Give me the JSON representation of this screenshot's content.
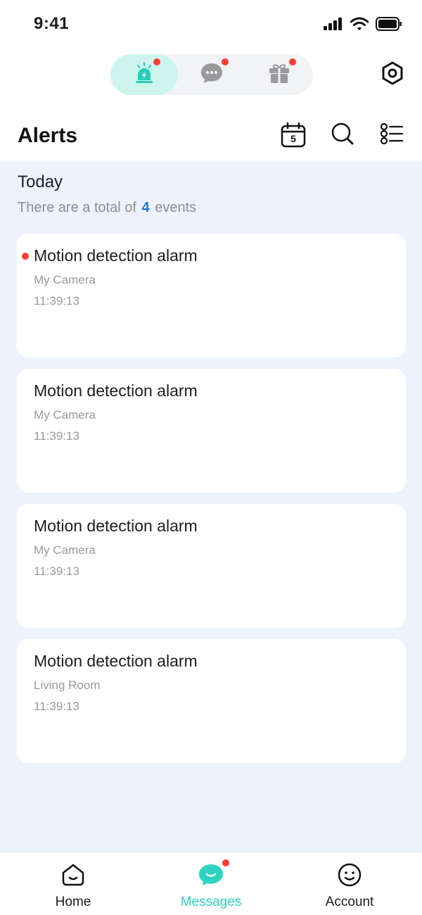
{
  "status_bar": {
    "time": "9:41"
  },
  "top_tabs": [
    {
      "name": "alerts",
      "icon": "siren-icon",
      "active": true,
      "badge": true
    },
    {
      "name": "chat",
      "icon": "chat-bubble-icon",
      "active": false,
      "badge": true
    },
    {
      "name": "gifts",
      "icon": "gift-icon",
      "active": false,
      "badge": true
    }
  ],
  "header": {
    "title": "Alerts",
    "calendar_day": "5"
  },
  "summary": {
    "day": "Today",
    "prefix": "There are a total of",
    "count": "4",
    "suffix": "events"
  },
  "events": [
    {
      "title": "Motion detection alarm",
      "device": "My Camera",
      "time": "11:39:13",
      "unread": true
    },
    {
      "title": "Motion detection alarm",
      "device": "My Camera",
      "time": "11:39:13",
      "unread": false
    },
    {
      "title": "Motion detection alarm",
      "device": "My Camera",
      "time": "11:39:13",
      "unread": false
    },
    {
      "title": "Motion detection alarm",
      "device": "Living Room",
      "time": "11:39:13",
      "unread": false
    }
  ],
  "bottom_nav": {
    "home": "Home",
    "messages": "Messages",
    "account": "Account"
  },
  "colors": {
    "accent": "#2ed3c1",
    "badge": "#ff3b30",
    "link": "#1a73e8",
    "list_background": "#eef2fd"
  }
}
